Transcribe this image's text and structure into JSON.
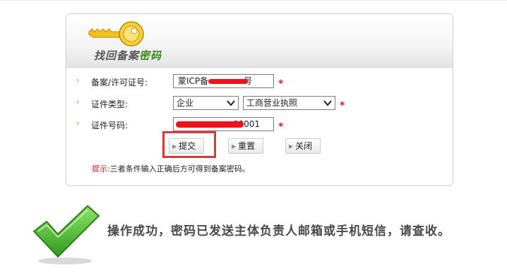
{
  "header": {
    "title_part1": "找回备案",
    "title_part2": "密码"
  },
  "form": {
    "icp_label": "备案/许可证号:",
    "icp_value_prefix": "蒙ICP备",
    "icp_value_suffix": "号",
    "cert_type_label": "证件类型:",
    "cert_type_option1": "企业",
    "cert_type_option2": "工商营业执照",
    "cert_no_label": "证件号码:",
    "cert_no_value_suffix": "00001",
    "required_mark": "*"
  },
  "buttons": {
    "submit": "提交",
    "reset": "重置",
    "close": "关闭"
  },
  "tip": {
    "label": "提示:",
    "text": "三者条件输入正确后方可得到备案密码。"
  },
  "result": {
    "message": "操作成功，密码已发送主体负责人邮箱或手机短信，请查收。"
  },
  "colors": {
    "accent_green": "#3a8a1a",
    "required_red": "#e02020",
    "highlight_border": "#d8393a",
    "check_green": "#3fae2a"
  }
}
